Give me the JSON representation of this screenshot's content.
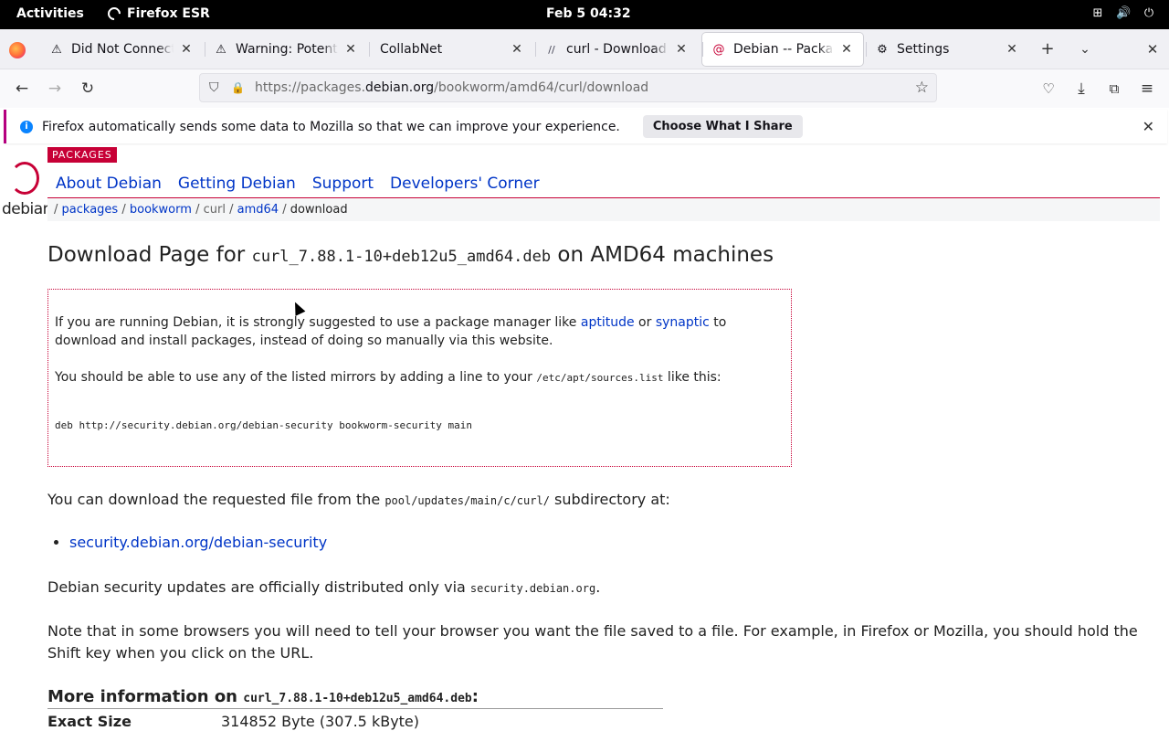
{
  "system": {
    "activities": "Activities",
    "app_name": "Firefox ESR",
    "clock": "Feb 5  04:32"
  },
  "tabs": [
    {
      "label": "Did Not Connect: P",
      "icon": "warning-icon"
    },
    {
      "label": "Warning: Potential",
      "icon": "warning-icon"
    },
    {
      "label": "CollabNet",
      "icon": ""
    },
    {
      "label": "curl - Download",
      "icon": "curl-icon"
    },
    {
      "label": "Debian -- Package",
      "icon": "debian-icon",
      "active": true
    },
    {
      "label": "Settings",
      "icon": "gear-icon"
    }
  ],
  "urlbar": {
    "prefix": "https://packages.",
    "domain": "debian.org",
    "path": "/bookworm/amd64/curl/download"
  },
  "notification": {
    "text": "Firefox automatically sends some data to Mozilla so that we can improve your experience.",
    "button": "Choose What I Share"
  },
  "site": {
    "badge": "PACKAGES",
    "logo_word": "debian",
    "nav": [
      "About Debian",
      "Getting Debian",
      "Support",
      "Developers' Corner"
    ],
    "breadcrumb": {
      "sep": "/",
      "packages": "packages",
      "bookworm": "bookworm",
      "curl": "curl",
      "amd64": "amd64",
      "download": "download"
    }
  },
  "content": {
    "title_pre": "Download Page for ",
    "filename": "curl_7.88.1-10+deb12u5_amd64.deb",
    "title_post": " on AMD64 machines",
    "note1_pre": "If you are running Debian, it is strongly suggested to use a package manager like ",
    "note1_link1": "aptitude",
    "note1_mid": " or ",
    "note1_link2": "synaptic",
    "note1_post": " to download and install packages, instead of doing so manually via this website.",
    "note2_pre": "You should be able to use any of the listed mirrors by adding a line to your ",
    "note2_code": "/etc/apt/sources.list",
    "note2_post": " like this:",
    "sources_line": "deb http://security.debian.org/debian-security bookworm-security main",
    "download_pre": "You can download the requested file from the ",
    "download_code": "pool/updates/main/c/curl/",
    "download_post": " subdirectory at:",
    "mirror_link": "security.debian.org/debian-security",
    "security_pre": "Debian security updates are officially distributed only via ",
    "security_code": "security.debian.org",
    "security_post": ".",
    "browser_note": "Note that in some browsers you will need to tell your browser you want the file saved to a file. For example, in Firefox or Mozilla, you should hold the Shift key when you click on the URL.",
    "more_pre": "More information on ",
    "more_post": ":",
    "size_key": "Exact Size",
    "size_value": "314852 Byte (307.5 kByte)"
  }
}
